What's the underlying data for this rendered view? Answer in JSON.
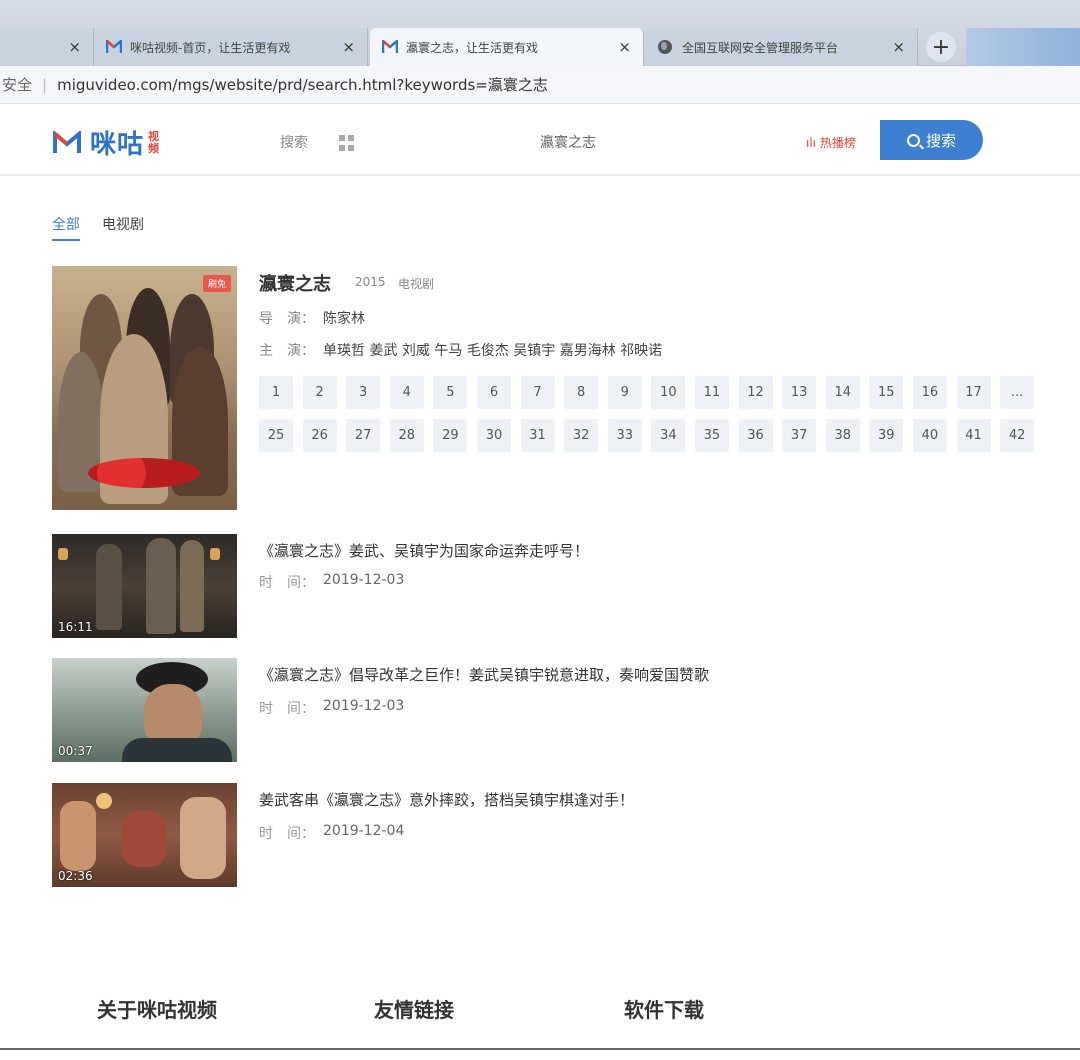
{
  "browser": {
    "tabs": [
      {
        "title": "",
        "close": "×"
      },
      {
        "title": "咪咕视频-首页，让生活更有戏",
        "close": "×"
      },
      {
        "title": "瀛寰之志，让生活更有戏",
        "close": "×"
      },
      {
        "title": "全国互联网安全管理服务平台",
        "close": "×"
      }
    ],
    "new_tab": "+",
    "security_label": "安全",
    "url": "miguvideo.com/mgs/website/prd/search.html?keywords=瀛寰之志"
  },
  "header": {
    "logo_text": "咪咕",
    "logo_sub_top": "视",
    "logo_sub_bottom": "频",
    "nav_search": "搜索",
    "search_query": "瀛寰之志",
    "hot_list": "热播榜",
    "search_button": "搜索"
  },
  "filters": [
    "全部",
    "电视剧"
  ],
  "series": {
    "badge": "刷免",
    "title": "瀛寰之志",
    "year": "2015",
    "type": "电视剧",
    "director_label": "导　演：",
    "director": "陈家林",
    "cast_label": "主　演：",
    "cast": "单瑛哲 姜武 刘威 午马 毛俊杰 吴镇宇 嘉男海林 祁映诺",
    "episodes": [
      "1",
      "2",
      "3",
      "4",
      "5",
      "6",
      "7",
      "8",
      "9",
      "10",
      "11",
      "12",
      "13",
      "14",
      "15",
      "16",
      "17",
      "...",
      "25",
      "26",
      "27",
      "28",
      "29",
      "30",
      "31",
      "32",
      "33",
      "34",
      "35",
      "36",
      "37",
      "38",
      "39",
      "40",
      "41",
      "42"
    ]
  },
  "clips": [
    {
      "title": "《瀛寰之志》姜武、吴镇宇为国家命运奔走呼号！",
      "time_label": "时　间：",
      "date": "2019-12-03",
      "duration": "16:11"
    },
    {
      "title": "《瀛寰之志》倡导改革之巨作！姜武吴镇宇锐意进取，奏响爱国赞歌",
      "time_label": "时　间：",
      "date": "2019-12-03",
      "duration": "00:37"
    },
    {
      "title": "姜武客串《瀛寰之志》意外摔跤，搭档吴镇宇棋逢对手！",
      "time_label": "时　间：",
      "date": "2019-12-04",
      "duration": "02:36"
    }
  ],
  "footer": {
    "about": "关于咪咕视频",
    "links": "友情链接",
    "download": "软件下载"
  },
  "colors": {
    "brand_blue": "#3d7fd0",
    "brand_red": "#e2463c"
  }
}
